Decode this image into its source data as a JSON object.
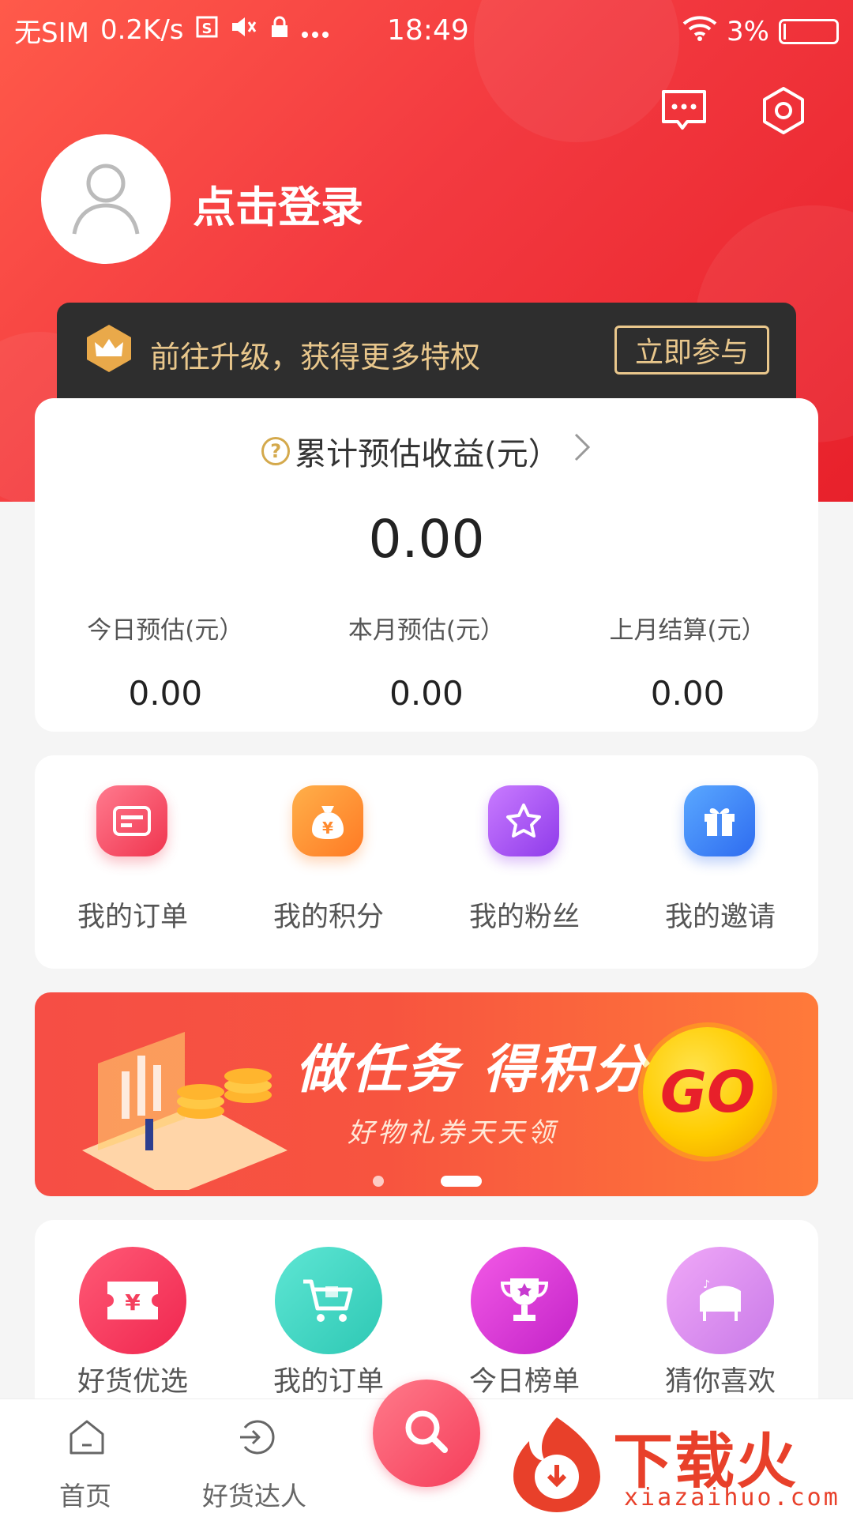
{
  "status_bar": {
    "carrier": "无SIM",
    "speed": "0.2K/s",
    "time": "18:49",
    "battery": "3%"
  },
  "header": {
    "login_label": "点击登录",
    "icons": [
      "message-icon",
      "settings-icon",
      "avatar-user-icon"
    ]
  },
  "upgrade": {
    "text": "前往升级，获得更多特权",
    "button": "立即参与"
  },
  "earnings": {
    "title": "累计预估收益(元）",
    "total": "0.00",
    "stats": [
      {
        "label": "今日预估(元）",
        "value": "0.00"
      },
      {
        "label": "本月预估(元）",
        "value": "0.00"
      },
      {
        "label": "上月结算(元）",
        "value": "0.00"
      }
    ]
  },
  "menu": [
    {
      "label": "我的订单",
      "icon": "order-card-icon",
      "color": "#f5475f"
    },
    {
      "label": "我的积分",
      "icon": "money-bag-icon",
      "color": "#ff8c2e"
    },
    {
      "label": "我的粉丝",
      "icon": "star-icon",
      "color": "#a64cf0"
    },
    {
      "label": "我的邀请",
      "icon": "gift-icon",
      "color": "#3e7ef5"
    }
  ],
  "promo": {
    "title": "做任务 得积分",
    "subtitle": "好物礼券天天领",
    "go": "GO"
  },
  "features": [
    {
      "label": "好货优选",
      "icon": "coupon-yen-icon",
      "color": "#f74064"
    },
    {
      "label": "我的订单",
      "icon": "cart-icon",
      "color": "#3fd8c4"
    },
    {
      "label": "今日榜单",
      "icon": "trophy-icon",
      "color": "#e03ad6"
    },
    {
      "label": "猜你喜欢",
      "icon": "piano-icon",
      "color": "#d98ef0"
    }
  ],
  "tabbar": {
    "home": "首页",
    "daren": "好货达人"
  },
  "watermark": {
    "brand": "下载火",
    "url": "xiazaihuo.com"
  }
}
